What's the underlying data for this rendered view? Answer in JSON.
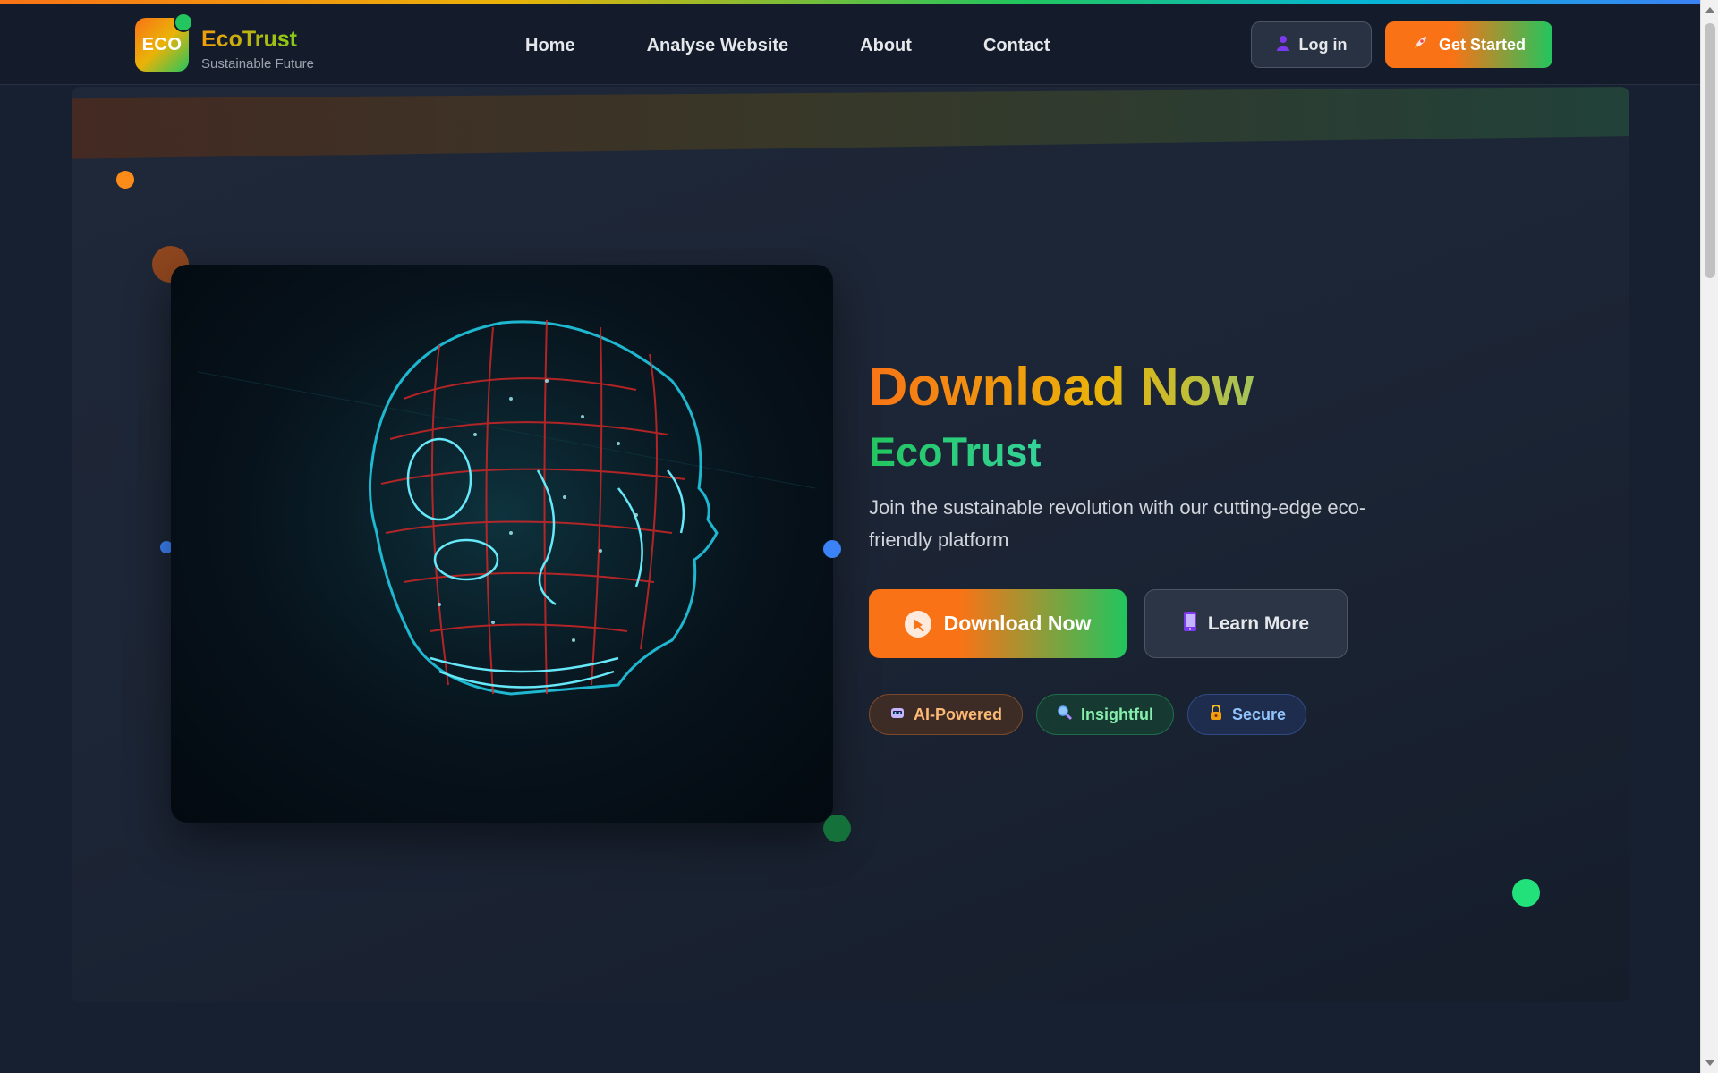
{
  "brand": {
    "logo_text": "ECO",
    "name": "EcoTrust",
    "tagline": "Sustainable Future"
  },
  "nav": {
    "links": [
      "Home",
      "Analyse Website",
      "About",
      "Contact"
    ],
    "login_label": "Log in",
    "login_icon": "user-icon",
    "get_started_label": "Get Started",
    "get_started_icon": "rocket-icon"
  },
  "hero": {
    "title": "Download Now",
    "subtitle": "EcoTrust",
    "description": "Join the sustainable revolution with our cutting-edge eco-friendly platform",
    "image": "wireframe-skull-hologram",
    "primary_button": {
      "label": "Download Now",
      "icon": "download-icon"
    },
    "secondary_button": {
      "label": "Learn More",
      "icon": "phone-icon"
    },
    "badges": [
      {
        "label": "AI-Powered",
        "icon": "robot-icon",
        "color": "#fdba74"
      },
      {
        "label": "Insightful",
        "icon": "magnifier-icon",
        "color": "#86efac"
      },
      {
        "label": "Secure",
        "icon": "lock-icon",
        "color": "#93c5fd"
      }
    ]
  },
  "colors": {
    "accent_orange": "#f97316",
    "accent_green": "#22c55e",
    "accent_blue": "#3b82f6",
    "background": "#172030"
  }
}
